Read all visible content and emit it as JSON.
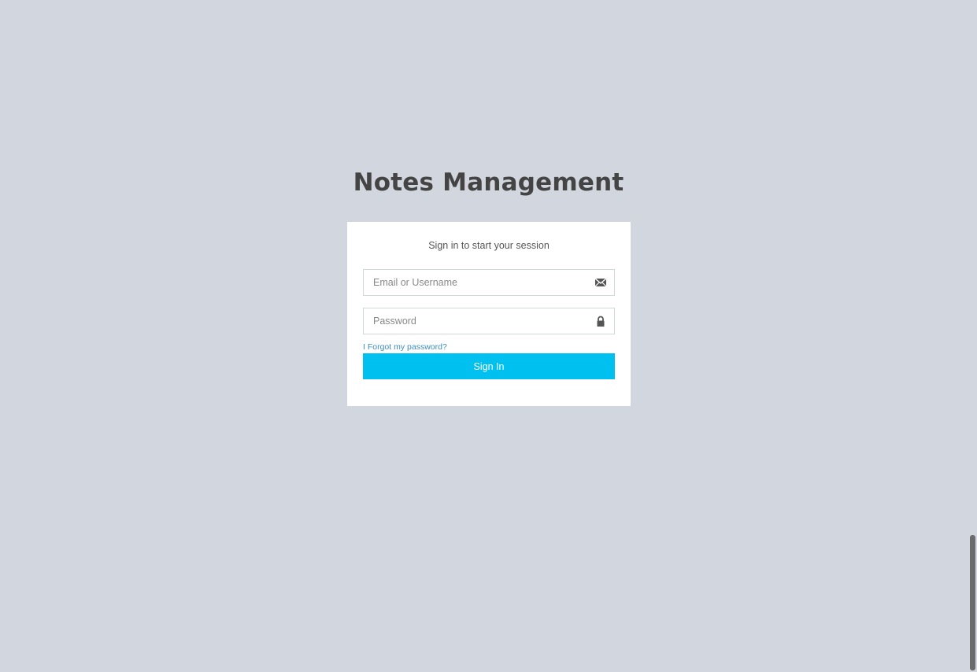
{
  "app": {
    "title": "Notes Management"
  },
  "login": {
    "message": "Sign in to start your session",
    "email_placeholder": "Email or Username",
    "password_placeholder": "Password",
    "forgot_label": "I Forgot my password?",
    "signin_label": "Sign In"
  },
  "icons": {
    "email": "envelope-icon",
    "password": "lock-icon"
  },
  "colors": {
    "background": "#d2d6de",
    "button": "#00c0ef",
    "link": "#3c8dbc",
    "title": "#444444"
  }
}
